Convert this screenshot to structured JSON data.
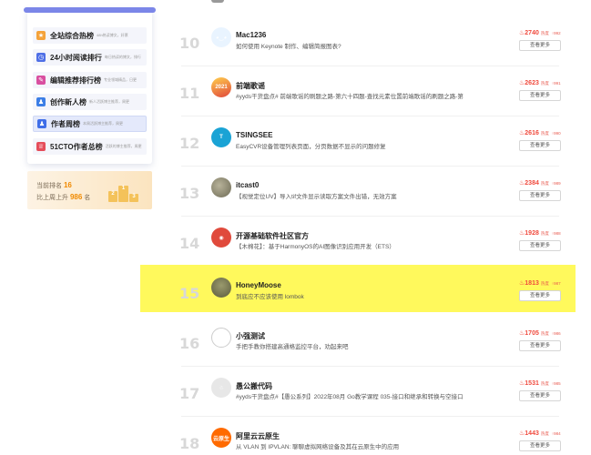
{
  "sidebar": {
    "items": [
      {
        "name": "全站综合热榜",
        "desc": "48h热读博文，好票",
        "icon": "medal-icon",
        "color": "#f4a23a",
        "glyph": "★"
      },
      {
        "name": "24小时阅读排行",
        "desc": "每日热读的博文，排行",
        "icon": "clock-icon",
        "color": "#4f6fe6",
        "glyph": "◷"
      },
      {
        "name": "编辑推荐排行榜",
        "desc": "专业领域精品，日更",
        "icon": "edit-icon",
        "color": "#d94fa0",
        "glyph": "✎"
      },
      {
        "name": "创作新人榜",
        "desc": "新人活跃博主推荐，周更",
        "icon": "new-user-icon",
        "color": "#3c7ee6",
        "glyph": "♟"
      },
      {
        "name": "作者周榜",
        "desc": "本周活跃博主推荐，周更",
        "icon": "author-icon",
        "color": "#3f6ee8",
        "glyph": "♟"
      },
      {
        "name": "51CTO作者总榜",
        "desc": "活跃的博主推荐，周更",
        "icon": "trophy-icon",
        "color": "#e54d5a",
        "glyph": "♕"
      }
    ],
    "active_index": 4
  },
  "rank_card": {
    "rank_label": "当前排名",
    "rank_value": "16",
    "rise_prefix": "比上周上升",
    "rise_value": "986",
    "rise_suffix": "名"
  },
  "list": {
    "button_label": "查看更多",
    "hot_tag": "热度",
    "rows": [
      {
        "rank": "10",
        "name": "Mac1236",
        "desc": "如何使用 Keynote 制作、编辑简报图表?",
        "score": "2740",
        "sub": "992",
        "avatar": "doraemon-avatar",
        "av_class": "av-blue",
        "av_text": "◕‿◕"
      },
      {
        "rank": "11",
        "name": "前端歌谣",
        "desc": "#yyds干货盘点# 前端歌谣的刷题之路-第六十四题-查找元素位置前端歌谣的刷题之路-第…",
        "score": "2623",
        "sub": "991",
        "avatar": "anniversary-avatar",
        "av_class": "av-2021",
        "av_text": "2021"
      },
      {
        "rank": "12",
        "name": "TSINGSEE",
        "desc": "EasyCVR设备管理列表页面，分页数据不显示的问题修复",
        "score": "2616",
        "sub": "990",
        "avatar": "t-logo-avatar",
        "av_class": "av-cyan",
        "av_text": "T"
      },
      {
        "rank": "13",
        "name": "itcast0",
        "desc": "【视觉定位UV】导入tif文件显示读取方案文件出错，无效方案",
        "score": "2384",
        "sub": "989",
        "avatar": "photo-avatar",
        "av_class": "av-photo",
        "av_text": ""
      },
      {
        "rank": "14",
        "name": "开源基础软件社区官方",
        "desc": "【木棉花】：基于HarmonyOS的AI图像识别应用开发（ETS）",
        "score": "1928",
        "sub": "988",
        "avatar": "openharmony-avatar",
        "av_class": "av-red",
        "av_text": "◉"
      },
      {
        "rank": "15",
        "name": "HoneyMoose",
        "desc": "到底应不应该使用 lombok",
        "score": "1813",
        "sub": "987",
        "avatar": "photo-avatar",
        "av_class": "av-olive",
        "av_text": ""
      },
      {
        "rank": "16",
        "name": "小强测试",
        "desc": "手把手教你搭建高通格监控平台，劝起来吧",
        "score": "1705",
        "sub": "986",
        "avatar": "six-avatar",
        "av_class": "av-white",
        "av_text": "6"
      },
      {
        "rank": "17",
        "name": "愚公搬代码",
        "desc": "#yyds干货盘点#【愚公系列】2022年08月 Go教学课程 035-接口和继承和转换与空接口",
        "score": "1531",
        "sub": "985",
        "avatar": "robot-avatar",
        "av_class": "av-grey",
        "av_text": "☃"
      },
      {
        "rank": "18",
        "name": "阿里云云原生",
        "desc": "从 VLAN 到 IPVLAN: 聊聊虚拟网络设备及其在云原生中的应用",
        "score": "1443",
        "sub": "984",
        "avatar": "aliyun-avatar",
        "av_class": "av-orange",
        "av_text": "云原生"
      }
    ],
    "highlight_index": 5
  }
}
